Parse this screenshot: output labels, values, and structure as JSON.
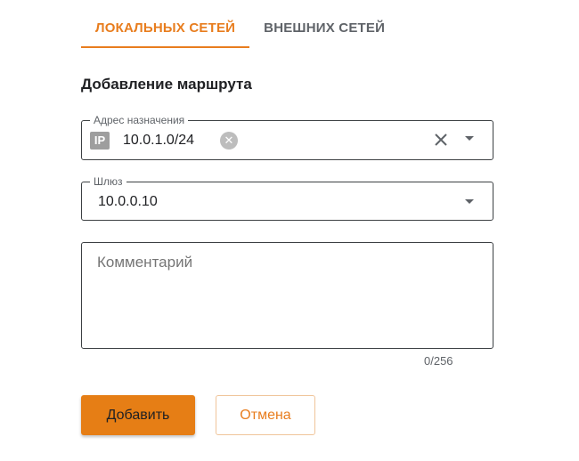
{
  "tabs": [
    {
      "label": "ЛОКАЛЬНЫХ СЕТЕЙ",
      "active": true
    },
    {
      "label": "ВНЕШНИХ СЕТЕЙ",
      "active": false
    }
  ],
  "form": {
    "title": "Добавление маршрута",
    "destination": {
      "label": "Адрес назначения",
      "chip_tag": "IP",
      "chip_value": "10.0.1.0/24"
    },
    "gateway": {
      "label": "Шлюз",
      "value": "10.0.0.10"
    },
    "comment": {
      "placeholder": "Комментарий",
      "counter": "0/256"
    }
  },
  "buttons": {
    "add_label": "Добавить",
    "cancel_label": "Отмена"
  },
  "colors": {
    "accent": "#e87d1e",
    "primary_button": "#e67e15"
  },
  "icons": {
    "chip_remove": "cancel-circle-icon",
    "clear": "close-icon",
    "dropdown": "arrow-drop-down-icon"
  }
}
